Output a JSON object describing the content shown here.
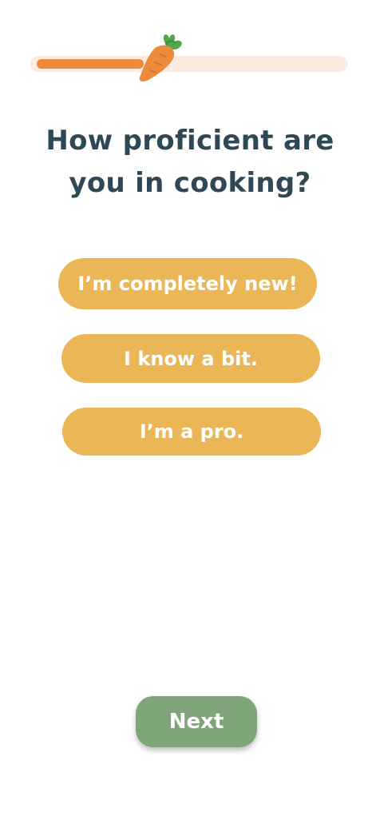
{
  "progress": {
    "value": 0.35,
    "track_color": "#fdebe0",
    "fill_color": "#ee8a3c",
    "marker_icon": "carrot-icon"
  },
  "question": {
    "title": "How proficient are you in cooking?"
  },
  "options": [
    {
      "label": "I’m completely new!"
    },
    {
      "label": "I know a bit."
    },
    {
      "label": "I’m a pro."
    }
  ],
  "next_button": {
    "label": "Next"
  },
  "colors": {
    "text": "#2f4856",
    "option": "#ebb756",
    "next": "#80a57a"
  }
}
